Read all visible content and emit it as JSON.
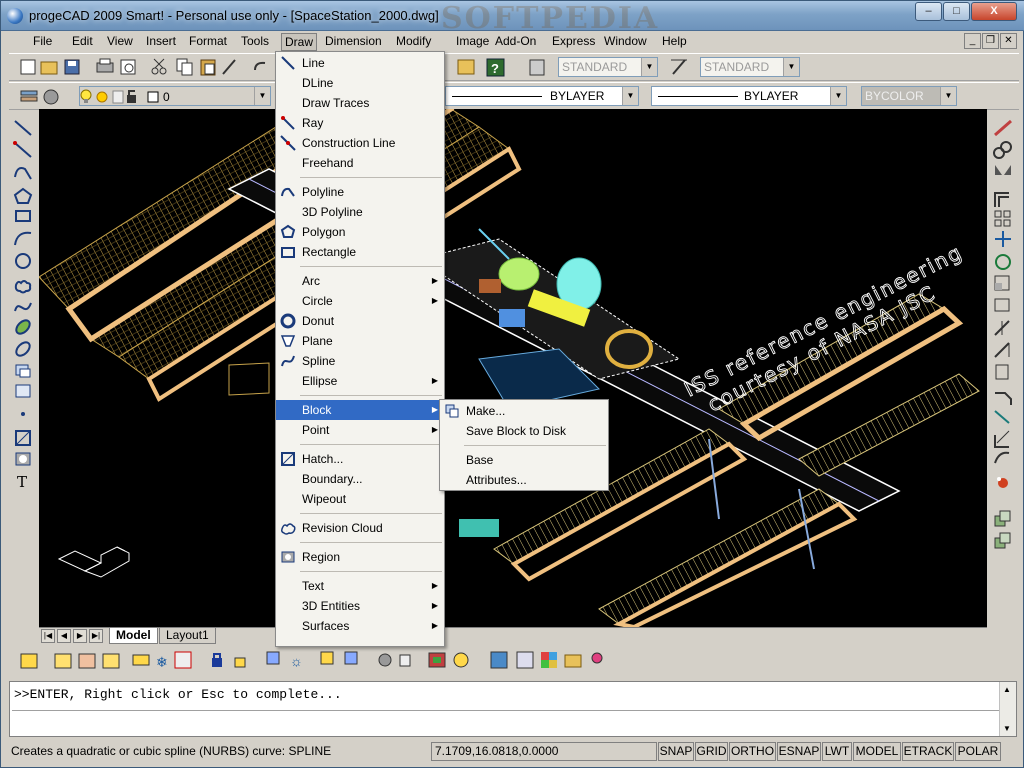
{
  "window": {
    "title": "progeCAD 2009 Smart! - Personal use only - [SpaceStation_2000.dwg]",
    "controls": {
      "minimize": "–",
      "maximize": "□",
      "close": "X"
    }
  },
  "menubar": {
    "items": [
      "File",
      "Edit",
      "View",
      "Insert",
      "Format",
      "Tools",
      "Draw",
      "Dimension",
      "Modify",
      "Image",
      "Add-On",
      "Express",
      "Window",
      "Help"
    ],
    "active": "Draw"
  },
  "toolbars": {
    "textstyle": "STANDARD",
    "dimstyle": "STANDARD",
    "layer": "0",
    "linetype": "BYLAYER",
    "lineweight": "BYLAYER",
    "color": "BYCOLOR"
  },
  "draw_menu": {
    "items": [
      {
        "label": "Line",
        "icon": "line-icon",
        "submenu": false
      },
      {
        "label": "DLine",
        "icon": "",
        "submenu": false
      },
      {
        "label": "Draw Traces",
        "icon": "",
        "submenu": false
      },
      {
        "label": "Ray",
        "icon": "ray-icon",
        "submenu": false
      },
      {
        "label": "Construction Line",
        "icon": "construction-line-icon",
        "submenu": false
      },
      {
        "label": "Freehand",
        "icon": "",
        "submenu": false
      },
      {
        "label": "Polyline",
        "icon": "polyline-icon",
        "submenu": false
      },
      {
        "label": "3D Polyline",
        "icon": "",
        "submenu": false
      },
      {
        "label": "Polygon",
        "icon": "polygon-icon",
        "submenu": false
      },
      {
        "label": "Rectangle",
        "icon": "rectangle-icon",
        "submenu": false
      },
      {
        "label": "Arc",
        "icon": "",
        "submenu": true
      },
      {
        "label": "Circle",
        "icon": "",
        "submenu": true
      },
      {
        "label": "Donut",
        "icon": "donut-icon",
        "submenu": false
      },
      {
        "label": "Plane",
        "icon": "plane-icon",
        "submenu": false
      },
      {
        "label": "Spline",
        "icon": "spline-icon",
        "submenu": false
      },
      {
        "label": "Ellipse",
        "icon": "",
        "submenu": true
      },
      {
        "label": "Block",
        "icon": "",
        "submenu": true
      },
      {
        "label": "Point",
        "icon": "",
        "submenu": true
      },
      {
        "label": "Hatch...",
        "icon": "hatch-icon",
        "submenu": false
      },
      {
        "label": "Boundary...",
        "icon": "",
        "submenu": false
      },
      {
        "label": "Wipeout",
        "icon": "",
        "submenu": false
      },
      {
        "label": "Revision Cloud",
        "icon": "revision-cloud-icon",
        "submenu": false
      },
      {
        "label": "Region",
        "icon": "region-icon",
        "submenu": false
      },
      {
        "label": "Text",
        "icon": "",
        "submenu": true
      },
      {
        "label": "3D Entities",
        "icon": "",
        "submenu": true
      },
      {
        "label": "Surfaces",
        "icon": "",
        "submenu": true
      }
    ],
    "highlighted": "Block"
  },
  "block_menu": {
    "items": [
      {
        "label": "Make...",
        "icon": "make-block-icon"
      },
      {
        "label": "Save Block to Disk",
        "icon": ""
      },
      {
        "label": "Base",
        "icon": ""
      },
      {
        "label": "Attributes...",
        "icon": ""
      }
    ]
  },
  "drawing": {
    "annotation_line1": "ISS reference engineering",
    "annotation_line2": "courtesy of NASA JSC"
  },
  "layout_tabs": {
    "tabs": [
      "Model",
      "Layout1"
    ],
    "active": "Model"
  },
  "command_line": {
    "text": ">>ENTER, Right click or Esc to complete..."
  },
  "status_bar": {
    "prompt": "Creates a quadratic or cubic spline (NURBS) curve:  SPLINE",
    "coords": "7.1709,16.0818,0.0000",
    "toggles": [
      "SNAP",
      "GRID",
      "ORTHO",
      "ESNAP",
      "LWT",
      "MODEL",
      "ETRACK",
      "POLAR"
    ]
  },
  "watermark": "SOFTPEDIA"
}
